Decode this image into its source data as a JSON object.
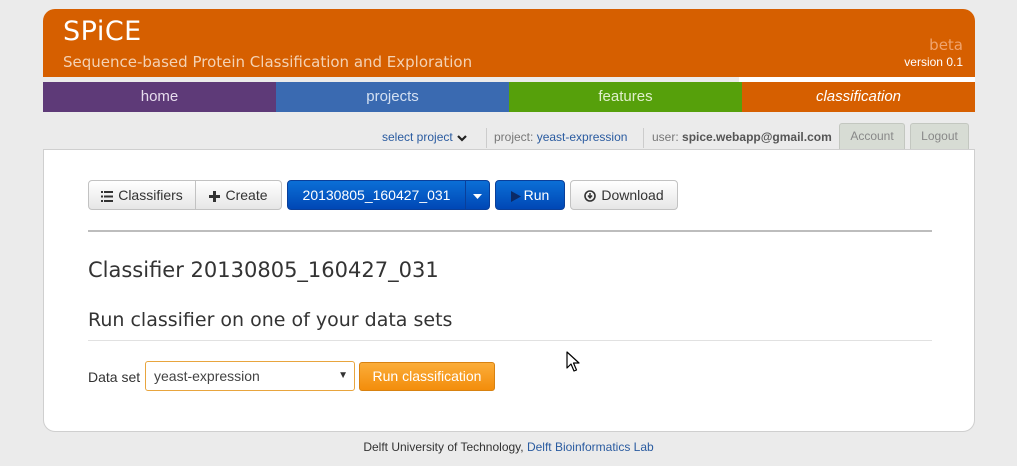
{
  "header": {
    "logo": "SPiCE",
    "tagline": "Sequence-based Protein Classification and Exploration",
    "beta": "beta",
    "version": "version 0.1"
  },
  "nav": {
    "home": "home",
    "projects": "projects",
    "features": "features",
    "classification": "classification"
  },
  "userbar": {
    "select_project": "select project",
    "project_label": "project:",
    "project_value": "yeast-expression",
    "user_label": "user:",
    "user_value": "spice.webapp@gmail.com",
    "account": "Account",
    "logout": "Logout"
  },
  "toolbar": {
    "classifiers": "Classifiers",
    "create": "Create",
    "classifier_id": "20130805_160427_031",
    "run": "Run",
    "download": "Download"
  },
  "main": {
    "title": "Classifier 20130805_160427_031",
    "subtitle": "Run classifier on one of your data sets",
    "dataset_label": "Data set",
    "dataset_value": "yeast-expression",
    "run_classification": "Run classification"
  },
  "footer": {
    "text": "Delft University of Technology,",
    "link": "Delft Bioinformatics Lab"
  },
  "colors": {
    "orange": "#d65f00",
    "purple": "#5e3a78",
    "blue": "#3a6ab1",
    "green": "#56a00b",
    "primary_button": "#0047b5",
    "run_classification": "#f38d0b"
  }
}
